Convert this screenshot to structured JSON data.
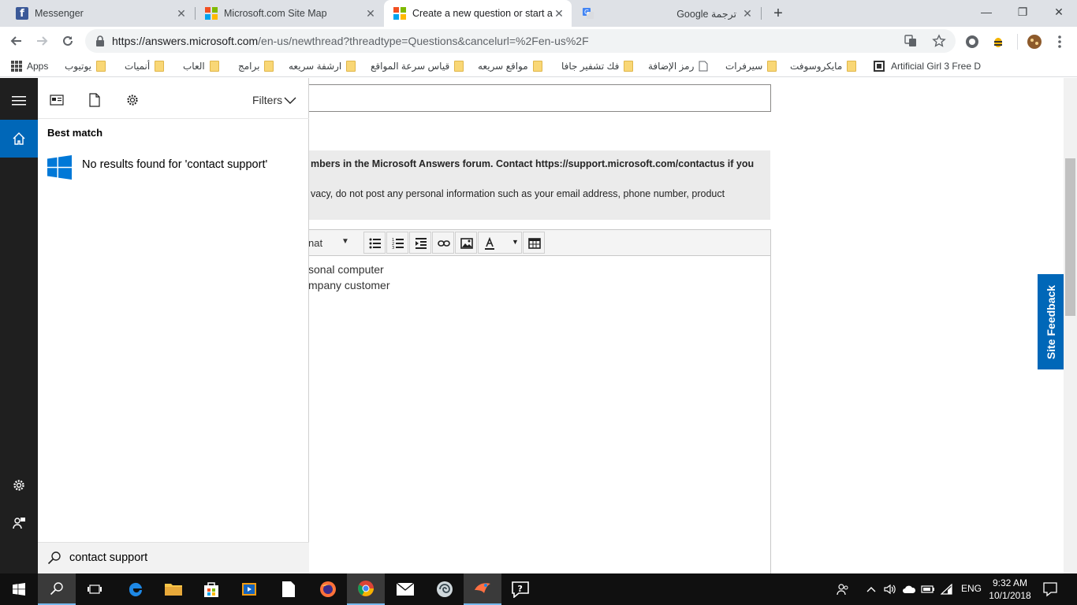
{
  "browser": {
    "tabs": [
      {
        "title": "Messenger",
        "favicon": "facebook-icon"
      },
      {
        "title": "Microsoft.com Site Map",
        "favicon": "microsoft-icon"
      },
      {
        "title": "Create a new question or start a",
        "favicon": "microsoft-icon",
        "active": true
      },
      {
        "title": "Google ترجمة",
        "favicon": "translate-icon"
      }
    ],
    "new_tab_symbol": "+",
    "window_controls": {
      "minimize": "—",
      "maximize": "❐",
      "close": "✕"
    },
    "url": {
      "host": "https://answers.microsoft.com",
      "path": "/en-us/newthread?threadtype=Questions&cancelurl=%2Fen-us%2F"
    }
  },
  "bookmarks": [
    {
      "label": "Apps",
      "type": "apps"
    },
    {
      "label": "يوتيوب",
      "type": "folder"
    },
    {
      "label": "أنميات",
      "type": "folder"
    },
    {
      "label": "العاب",
      "type": "folder"
    },
    {
      "label": "برامج",
      "type": "folder"
    },
    {
      "label": "ارشفة سريعه",
      "type": "folder"
    },
    {
      "label": "قياس سرعة المواقع",
      "type": "folder"
    },
    {
      "label": "مواقع سريعه",
      "type": "folder"
    },
    {
      "label": "فك تشفير جافا",
      "type": "folder"
    },
    {
      "label": "رمز الإضافة",
      "type": "page"
    },
    {
      "label": "سيرفرات",
      "type": "folder"
    },
    {
      "label": "مايكروسوفت",
      "type": "folder"
    },
    {
      "label": "Artificial Girl 3 Free D",
      "type": "site"
    }
  ],
  "page": {
    "notice_line1": "mbers in the Microsoft Answers forum. Contact https://support.microsoft.com/contactus if you",
    "notice_line2": "vacy, do not post any personal information such as your email address, phone number, product",
    "editor": {
      "format_label": "nat",
      "body_lines": [
        "sonal computer",
        "mpany customer"
      ]
    },
    "site_feedback": "Site Feedback"
  },
  "search": {
    "filters_label": "Filters",
    "best_match_label": "Best match",
    "result_text": "No results found for 'contact support'",
    "query": "contact support"
  },
  "taskbar": {
    "language": "ENG",
    "time": "9:32 AM",
    "date": "10/1/2018"
  },
  "colors": {
    "accent_blue": "#0067b8",
    "taskbar": "#101010",
    "tab_strip": "#dee1e6"
  }
}
